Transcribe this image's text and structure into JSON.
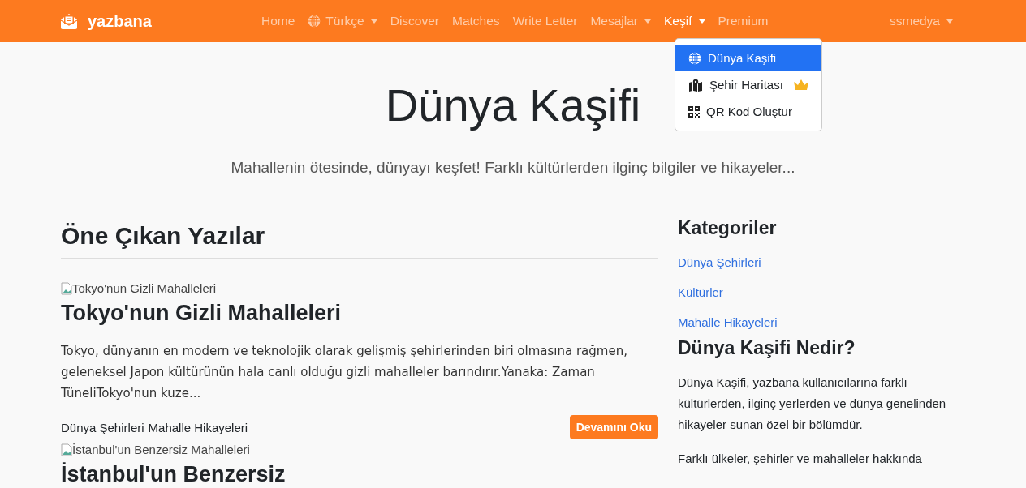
{
  "navbar": {
    "brand": "yazbana",
    "items": [
      {
        "label": "Home",
        "dropdown": false,
        "active": false
      },
      {
        "label": "Türkçe",
        "dropdown": true,
        "active": false
      },
      {
        "label": "Discover",
        "dropdown": false,
        "active": false
      },
      {
        "label": "Matches",
        "dropdown": false,
        "active": false
      },
      {
        "label": "Write Letter",
        "dropdown": false,
        "active": false
      },
      {
        "label": "Mesajlar",
        "dropdown": true,
        "active": false
      },
      {
        "label": "Keşif",
        "dropdown": true,
        "active": true
      },
      {
        "label": "Premium",
        "dropdown": false,
        "active": false
      }
    ],
    "user": {
      "label": "ssmedya",
      "dropdown": true
    }
  },
  "dropdown_menu": {
    "items": [
      {
        "label": "Dünya Kaşifi",
        "selected": true,
        "premium": false
      },
      {
        "label": "Şehir Haritası",
        "selected": false,
        "premium": true
      },
      {
        "label": "QR Kod Oluştur",
        "selected": false,
        "premium": false
      }
    ]
  },
  "hero": {
    "title": "Dünya Kaşifi",
    "subtitle": "Mahallenin ötesinde, dünyayı keşfet! Farklı kültürlerden ilginç bilgiler ve hikayeler..."
  },
  "featured": {
    "heading": "Öne Çıkan Yazılar",
    "posts": [
      {
        "image_alt": "Tokyo'nun Gizli Mahalleleri",
        "title": "Tokyo'nun Gizli Mahalleleri",
        "excerpt": "Tokyo, dünyanın en modern ve teknolojik olarak gelişmiş şehirlerinden biri olmasına rağmen, geleneksel Japon kültürünün hala canlı olduğu gizli mahalleler barındırır.Yanaka: Zaman TüneliTokyo'nun kuze...",
        "tags": [
          "Dünya Şehirleri",
          "Mahalle Hikayeleri"
        ],
        "button": "Devamını Oku"
      },
      {
        "image_alt": "İstanbul'un Benzersiz Mahalleleri",
        "title": "İstanbul'un Benzersiz"
      }
    ]
  },
  "sidebar": {
    "heading": "Kategoriler",
    "categories": [
      "Dünya Şehirleri",
      "Kültürler",
      "Mahalle Hikayeleri"
    ],
    "about_heading": "Dünya Kaşifi Nedir?",
    "paragraphs": [
      "Dünya Kaşifi, yazbana kullanıcılarına farklı kültürlerden, ilginç yerlerden ve dünya genelinden hikayeler sunan özel bir bölümdür.",
      "Farklı ülkeler, şehirler ve mahalleler hakkında"
    ]
  }
}
